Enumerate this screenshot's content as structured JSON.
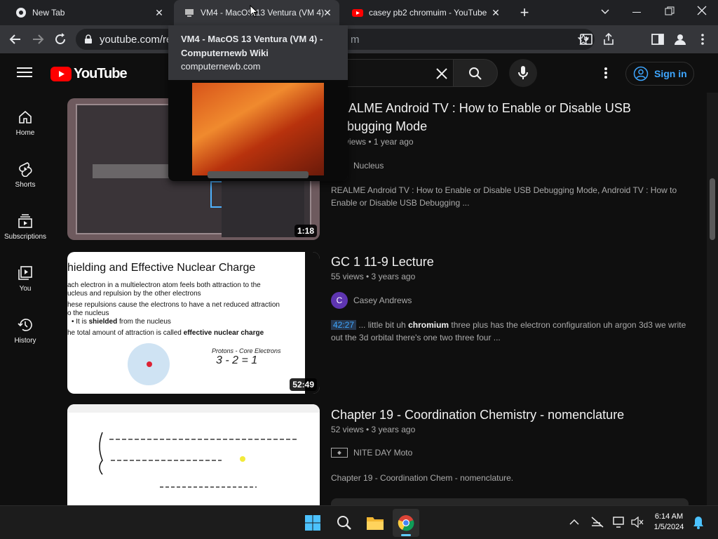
{
  "browser": {
    "tabs": [
      {
        "title": "New Tab"
      },
      {
        "title": "VM4 - MacOS 13 Ventura (VM 4)"
      },
      {
        "title": "casey pb2 chromuim - YouTube"
      }
    ],
    "url": "youtube.com/re",
    "url_tail": "m"
  },
  "hovercard": {
    "title": "VM4 - MacOS 13 Ventura (VM 4) - Computernewb Wiki",
    "domain": "computernewb.com"
  },
  "youtube": {
    "logo_text": "YouTube",
    "sign_in": "Sign in",
    "sidebar": [
      {
        "label": "Home",
        "icon": "home-icon"
      },
      {
        "label": "Shorts",
        "icon": "shorts-icon"
      },
      {
        "label": "Subscriptions",
        "icon": "subscriptions-icon"
      },
      {
        "label": "You",
        "icon": "you-icon"
      },
      {
        "label": "History",
        "icon": "history-icon"
      }
    ],
    "results": [
      {
        "title_line1": "REALME Android TV : How to Enable or Disable USB",
        "title_line2": "Debugging Mode",
        "meta": "views • 1 year ago",
        "channel": "Nucleus",
        "desc_line1": "REALME Android TV : How to Enable or Disable USB Debugging Mode, Android TV : How to",
        "desc_line2": "Enable or Disable USB Debugging ...",
        "duration": "1:18"
      },
      {
        "title_line1": "GC 1 11-9 Lecture",
        "meta": "55 views • 3 years ago",
        "channel": "Casey Andrews",
        "channel_initial": "C",
        "chip": "42:27",
        "desc_pre": " ... little bit uh ",
        "desc_bold": "chromium",
        "desc_post": " three plus has the electron configuration uh argon 3d3 we write",
        "desc_line2": "out the 3d orbital there's one two three four ...",
        "duration": "52:49",
        "slide": {
          "heading": "hielding and Effective Nuclear Charge",
          "b1a": "ach electron in a multielectron atom feels both attraction to the",
          "b1b": "ucleus and repulsion by the other electrons",
          "b2a": "hese repulsions cause the electrons to have a net reduced attraction",
          "b2b": "o the nucleus",
          "b3_pre": "It is ",
          "b3_bold": "shielded",
          "b3_post": " from the nucleus",
          "b4_pre": "he total amount of attraction is called ",
          "b4_bold": "effective nuclear charge",
          "hand1": "Protons - Core Electrons",
          "hand2": "3 - 2 = 1"
        }
      },
      {
        "title_line1": "Chapter 19 - Coordination Chemistry - nomenclature",
        "meta": "52 views • 3 years ago",
        "channel": "NITE DAY Moto",
        "desc_line1": "Chapter 19 - Coordination Chem - nomenclature."
      }
    ]
  },
  "taskbar": {
    "time": "6:14 AM",
    "date": "1/5/2024"
  },
  "colors": {
    "youtube_red": "#ff0000",
    "link_blue": "#3ea6ff",
    "tab_active": "#35363a",
    "page_bg": "#0f0f0f"
  }
}
